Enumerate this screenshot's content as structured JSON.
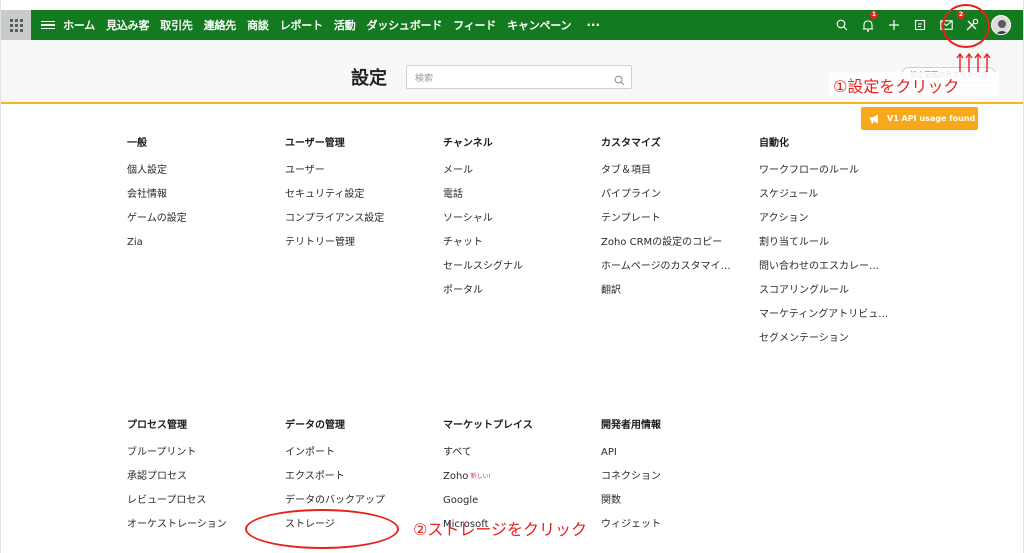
{
  "nav": {
    "items": [
      "ホーム",
      "見込み客",
      "取引先",
      "連絡先",
      "商談",
      "レポート",
      "活動",
      "ダッシュボード",
      "フィード",
      "キャンペーン"
    ],
    "more": "···",
    "notification_badge": "1",
    "setup_badge": "2"
  },
  "header": {
    "title": "設定",
    "search_placeholder": "検索",
    "customize_label": "設定画面のカスタマイズ"
  },
  "api_button": "V1 API usage found",
  "sections_top": [
    {
      "title": "一般",
      "items": [
        "個人設定",
        "会社情報",
        "ゲームの設定",
        "Zia"
      ]
    },
    {
      "title": "ユーザー管理",
      "items": [
        "ユーザー",
        "セキュリティ設定",
        "コンプライアンス設定",
        "テリトリー管理"
      ]
    },
    {
      "title": "チャンネル",
      "items": [
        "メール",
        "電話",
        "ソーシャル",
        "チャット",
        "セールスシグナル",
        "ポータル"
      ]
    },
    {
      "title": "カスタマイズ",
      "items": [
        "タブ＆項目",
        "パイプライン",
        "テンプレート",
        "Zoho CRMの設定のコピー",
        "ホームページのカスタマイ…",
        "翻訳"
      ]
    },
    {
      "title": "自動化",
      "items": [
        "ワークフローのルール",
        "スケジュール",
        "アクション",
        "割り当てルール",
        "問い合わせのエスカレー…",
        "スコアリングルール",
        "マーケティングアトリビュ…",
        "セグメンテーション"
      ]
    }
  ],
  "sections_bottom": [
    {
      "title": "プロセス管理",
      "items": [
        "ブループリント",
        "承認プロセス",
        "レビュープロセス",
        "オーケストレーション"
      ]
    },
    {
      "title": "データの管理",
      "items": [
        "インポート",
        "エクスポート",
        "データのバックアップ",
        "ストレージ"
      ]
    },
    {
      "title": "マーケットプレイス",
      "items": [
        "すべて",
        "Zoho",
        "Google",
        "Microsoft"
      ],
      "new_tag": "新しい!"
    },
    {
      "title": "開発者用情報",
      "items": [
        "API",
        "コネクション",
        "関数",
        "ウィジェット"
      ]
    }
  ],
  "annotations": {
    "step1": "①設定をクリック",
    "step2": "②ストレージをクリック"
  },
  "colors": {
    "nav_green": "#137a20",
    "accent_yellow": "#f2b81a",
    "api_orange": "#f8a91b",
    "annotation_red": "#e8211b"
  }
}
